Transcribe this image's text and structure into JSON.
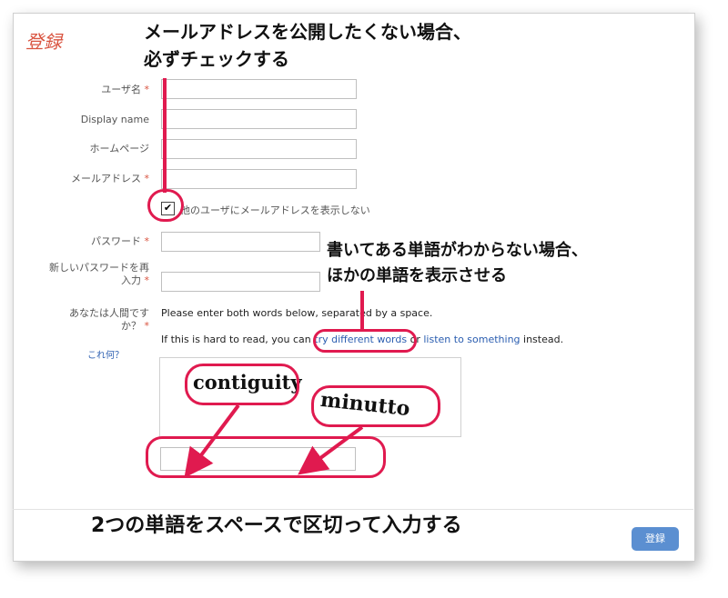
{
  "form": {
    "title": "登録",
    "fields": [
      {
        "label": "ユーザ名",
        "required": "*"
      },
      {
        "label": "Display name",
        "required": ""
      },
      {
        "label": "ホームページ",
        "required": ""
      },
      {
        "label": "メールアドレス",
        "required": "*"
      }
    ],
    "hide_email_checkbox": {
      "checked_mark": "✔",
      "label": "他のユーザにメールアドレスを表示しない"
    },
    "password": {
      "label": "パスワード",
      "required": "*"
    },
    "password_confirm": {
      "label_line1": "新しいパスワードを再",
      "label_line2": "入力",
      "required": "*"
    },
    "human": {
      "label_line1": "あなたは人間です",
      "label_line2": "か？",
      "required": "*",
      "help_link": "これ何？"
    },
    "captcha": {
      "instruction": "Please enter both words below, separated by a space.",
      "hint_prefix": "If this is hard to read, you can",
      "try_link": "try different words",
      "or": "or",
      "listen_link": "listen to something",
      "hint_suffix": "instead.",
      "word1": "contiguity",
      "word2": "minutto"
    },
    "submit_label": "登録"
  },
  "annotations": {
    "email_line1": "メールアドレスを公開したくない場合、",
    "email_line2": "必ずチェックする",
    "words_line1": "書いてある単語がわからない場合、",
    "words_line2": "ほかの単語を表示させる",
    "input_note": "2つの単語をスペースで区切って入力する"
  },
  "colors": {
    "accent_red": "#e01a4f",
    "title_red": "#d9533f",
    "link_blue": "#2a5db0",
    "button_blue": "#5b8fd1"
  }
}
